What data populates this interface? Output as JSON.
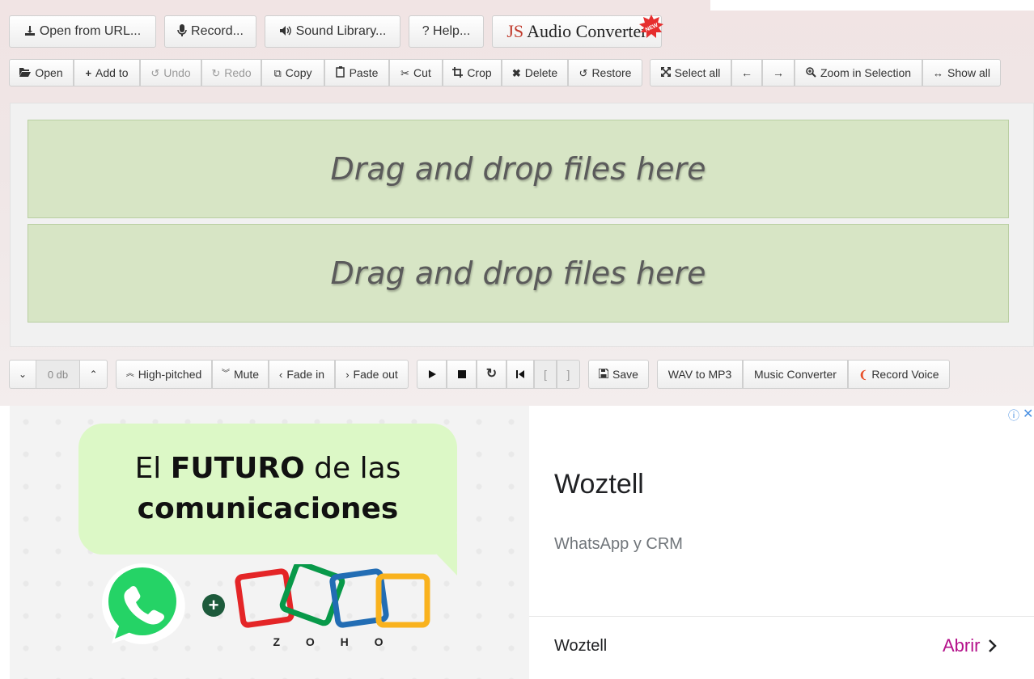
{
  "toolbar_top": {
    "open_url": "Open from URL...",
    "record": "Record...",
    "sound_library": "Sound Library...",
    "help": "? Help...",
    "logo_js": "JS",
    "logo_text": "Audio Converter",
    "new_badge": "NEW"
  },
  "toolbar_edit": {
    "open": "Open",
    "add_to": "Add to",
    "undo": "Undo",
    "redo": "Redo",
    "copy": "Copy",
    "paste": "Paste",
    "cut": "Cut",
    "crop": "Crop",
    "delete": "Delete",
    "restore": "Restore",
    "select_all": "Select all",
    "arrow_left": "←",
    "arrow_right": "→",
    "zoom_in_selection": "Zoom in Selection",
    "show_all": "Show all"
  },
  "dropzones": {
    "top": "Drag and drop files here",
    "bottom": "Drag and drop files here"
  },
  "toolbar_bottom": {
    "volume_down": "⌄",
    "db_value": "0 db",
    "volume_up": "⌃",
    "high_pitched": "High-pitched",
    "mute": "Mute",
    "fade_in": "Fade in",
    "fade_out": "Fade out",
    "bracket_left": "[",
    "bracket_right": "]",
    "save": "Save",
    "wav_to_mp3": "WAV to MP3",
    "music_converter": "Music Converter",
    "record_voice": "Record Voice"
  },
  "ad": {
    "headline_line1_pre": "El ",
    "headline_line1_bold": "FUTURO",
    "headline_line1_post": " de las",
    "headline_line2": "comunicaciones",
    "brand": "Z O H O",
    "plus": "+",
    "title": "Woztell",
    "subtitle": "WhatsApp y CRM",
    "footer_name": "Woztell",
    "cta": "Abrir",
    "info_icon": "ⓘ",
    "close_icon": "✕"
  },
  "colors": {
    "dropzone_bg": "#d7e5c5",
    "cta": "#b4108a",
    "whatsapp_green": "#25d366"
  }
}
